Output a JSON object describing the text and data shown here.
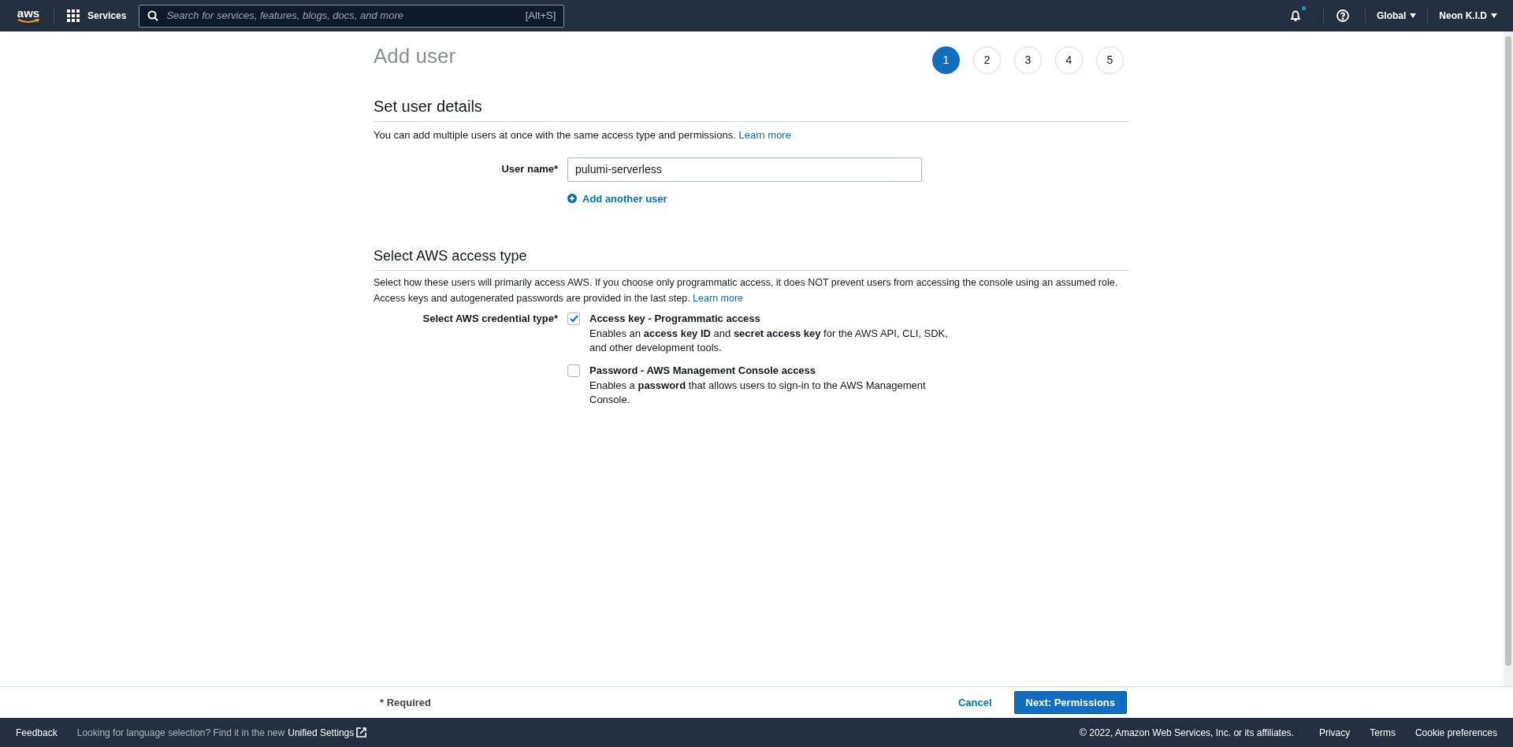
{
  "header": {
    "logo": "aws",
    "services": "Services",
    "search": {
      "placeholder": "Search for services, features, blogs, docs, and more",
      "shortcut": "[Alt+S]"
    },
    "notifications": {
      "unread": true
    },
    "region": "Global",
    "account": "Neon K.I.D"
  },
  "title": "Add user",
  "steps": [
    {
      "label": "1",
      "selected": true
    },
    {
      "label": "2",
      "selected": false
    },
    {
      "label": "3",
      "selected": false
    },
    {
      "label": "4",
      "selected": false
    },
    {
      "label": "5",
      "selected": false
    }
  ],
  "details": {
    "heading": "Set user details",
    "description": "You can add multiple users at once with the same access type and permissions.",
    "link": "Learn more",
    "user_name": {
      "label": "User name*",
      "value": "pulumi-serverless"
    },
    "add_another": "Add another user"
  },
  "access": {
    "heading": "Select AWS access type",
    "description": "Select how these users will primarily access AWS. If you choose only programmatic access, it does NOT prevent users from accessing the console using an assumed role. Access keys and autogenerated passwords are provided in the last step.",
    "link": "Learn more",
    "credential_label": "Select AWS credential type*",
    "options": [
      {
        "title": "Access key - Programmatic access",
        "text": "Enables an **access key ID** and **secret access key** for the AWS API, CLI, SDK, and other development tools.",
        "checked": true
      },
      {
        "title": "Password - AWS Management Console access",
        "text": "Enables a **password** that allows users to sign-in to the AWS Management Console.",
        "checked": false
      }
    ]
  },
  "actions": {
    "required": "* Required",
    "cancel": "Cancel",
    "next": "Next: Permissions"
  },
  "footer": {
    "feedback": "Feedback",
    "notice": "Looking for language selection? Find it in the new",
    "settings_link": "Unified Settings",
    "copyright": "© 2022, Amazon Web Services, Inc. or its affiliates.",
    "links": [
      "Privacy",
      "Terms",
      "Cookie preferences"
    ]
  }
}
